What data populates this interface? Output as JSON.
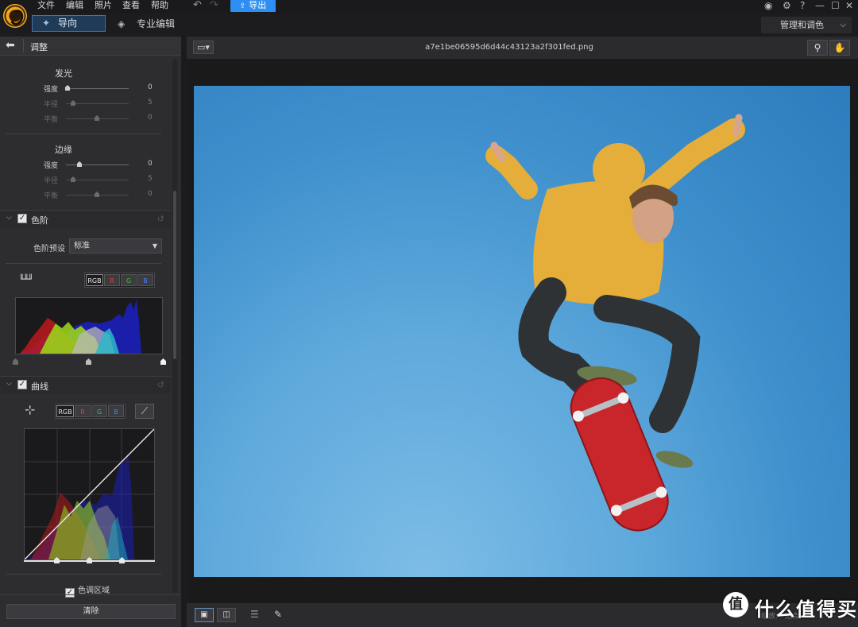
{
  "menu": {
    "items": [
      "文件",
      "编辑",
      "照片",
      "查看",
      "帮助"
    ],
    "export_label": "导出"
  },
  "modes": {
    "guide": "导向",
    "pro": "专业编辑",
    "manage_dropdown": "管理和调色"
  },
  "panel": {
    "title": "调整",
    "glow": {
      "title": "发光",
      "sliders": [
        {
          "label": "强度",
          "value": "0",
          "level": 0.0,
          "enabled": true
        },
        {
          "label": "半径",
          "value": "5",
          "level": 0.1,
          "enabled": false
        },
        {
          "label": "平衡",
          "value": "0",
          "level": 0.5,
          "enabled": false
        }
      ]
    },
    "edge": {
      "title": "边缘",
      "sliders": [
        {
          "label": "强度",
          "value": "0",
          "level": 0.2,
          "enabled": true
        },
        {
          "label": "半径",
          "value": "5",
          "level": 0.1,
          "enabled": false
        },
        {
          "label": "平衡",
          "value": "0",
          "level": 0.5,
          "enabled": false
        }
      ]
    },
    "levels": {
      "title": "色阶",
      "preset_label": "色阶预设",
      "preset_value": "标准",
      "channels": [
        "RGB",
        "R",
        "G",
        "B"
      ]
    },
    "curves": {
      "title": "曲线",
      "channels": [
        "RGB",
        "R",
        "G",
        "B"
      ]
    },
    "tone_area": "色调区域",
    "clear_button": "清除"
  },
  "viewer": {
    "file_name": "a7e1be06595d6d44c43123a2f301fed.png",
    "zoom_label": "缩放:",
    "zoom_value": "适合"
  },
  "watermark": {
    "badge": "值",
    "text": "什么值得买"
  },
  "colors": {
    "accent": "#2e8ff2",
    "panel_bg": "#2d2d30",
    "sky": "#3e8fcc",
    "hoodie": "#e5ae3a",
    "skateboard": "#c8262a"
  }
}
